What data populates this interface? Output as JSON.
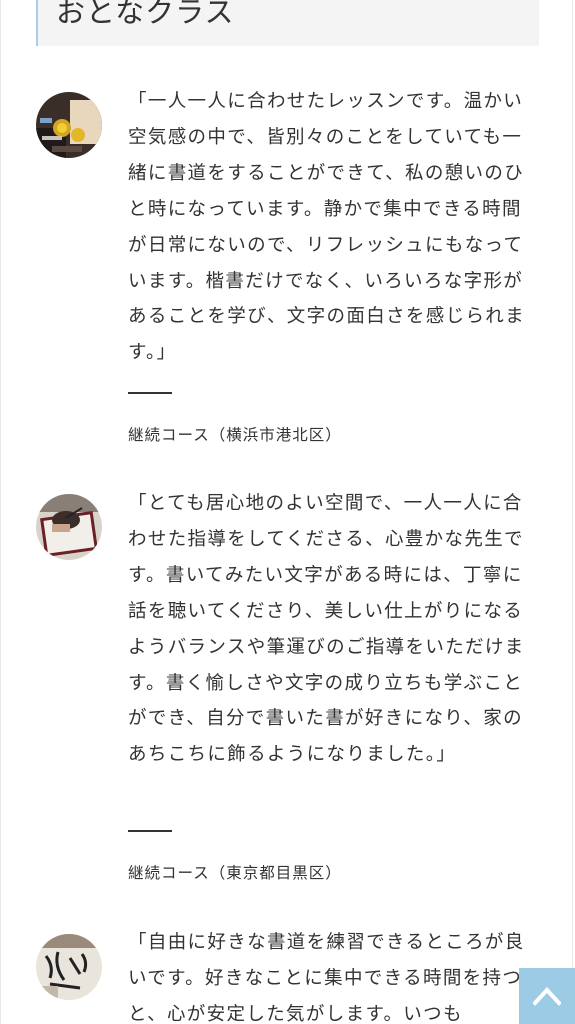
{
  "section": {
    "heading": "おとなクラス"
  },
  "voices": [
    {
      "avatar_icon": "calligraphy-tools-photo-icon",
      "text": "「一人一人に合わせたレッスンです。温かい空気感の中で、皆別々のことをしていても一緒に書道をすることができて、私の憩いのひと時になっています。静かで集中できる時間が日常にないので、リフレッシュにもなっています。楷書だけでなく、いろいろな字形があることを学び、文字の面白さを感じられます。」",
      "course": "継続コース（横浜市港北区）"
    },
    {
      "avatar_icon": "writing-hand-photo-icon",
      "text": "「とても居心地のよい空間で、一人一人に合わせた指導をしてくださる、心豊かな先生です。書いてみたい文字がある時には、丁寧に話を聴いてくださり、美しい仕上がりになるようバランスや筆運びのご指導をいただけます。書く愉しさや文字の成り立ちも学ぶことができ、自分で書いた書が好きになり、家のあちこちに飾るようになりました。」",
      "course": "継続コース（東京都目黒区）"
    },
    {
      "avatar_icon": "calligraphy-paper-photo-icon",
      "text": "「自由に好きな書道を練習できるところが良いです。好きなことに集中できる時間を持つと、心が安定した気がします。いつも",
      "course": ""
    }
  ],
  "scroll_top": {
    "icon": "chevron-up-icon",
    "color": "#9ccbe6"
  }
}
